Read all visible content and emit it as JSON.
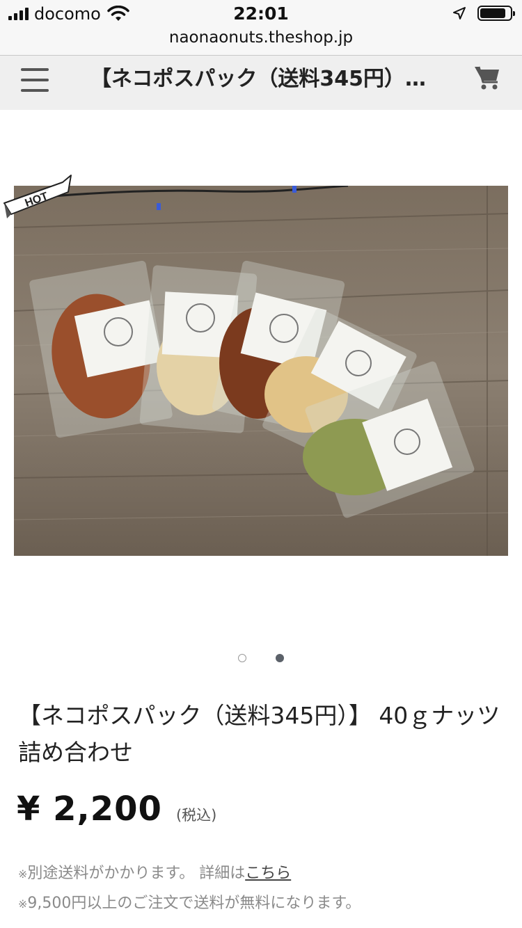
{
  "status_bar": {
    "carrier": "docomo",
    "time": "22:01",
    "icons": [
      "signal-icon",
      "wifi-icon",
      "location-arrow-icon",
      "battery-icon"
    ],
    "battery_level": 0.85
  },
  "browser": {
    "url": "naonaonuts.theshop.jp"
  },
  "header": {
    "menu_icon": "hamburger-menu-icon",
    "title": "【ネコポスパック（送料345円）…",
    "cart_icon": "shopping-cart-icon"
  },
  "product": {
    "badge": "HOT",
    "name": "【ネコポスパック（送料345円）】 40ｇナッツ詰め合わせ",
    "price": "¥ 2,200",
    "tax_note": "(税込)",
    "carousel": {
      "count": 2,
      "active_index": 1
    },
    "shipping_note": {
      "mark": "※",
      "text": "別途送料がかかります。 詳細は",
      "link": "こちら"
    },
    "free_shipping_note": {
      "mark": "※",
      "text": "9,500円以上のご注文で送料が無料になります。"
    }
  },
  "colors": {
    "header_bg": "#efefef",
    "dot_active": "#5b6169",
    "note_text": "#8a8a8a"
  }
}
